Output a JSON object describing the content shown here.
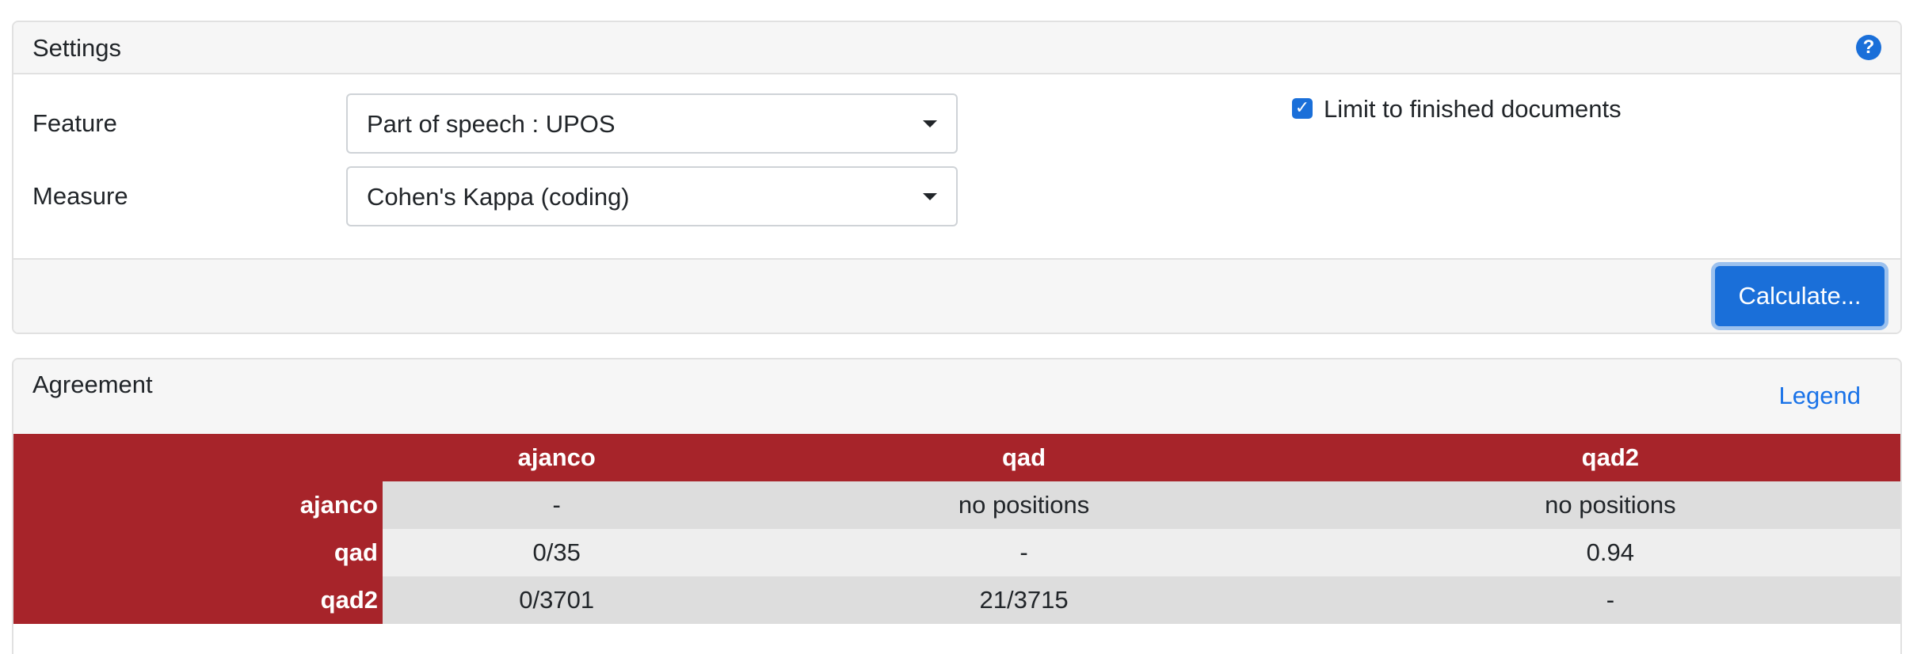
{
  "settings": {
    "title": "Settings",
    "help_icon": "?",
    "feature_label": "Feature",
    "feature_value": "Part of speech : UPOS",
    "measure_label": "Measure",
    "measure_value": "Cohen's Kappa (coding)",
    "limit_label": "Limit to finished documents",
    "limit_checked": true,
    "calculate_label": "Calculate..."
  },
  "agreement": {
    "title": "Agreement",
    "legend_label": "Legend",
    "header_color": "#a7242a",
    "columns": [
      "ajanco",
      "qad",
      "qad2"
    ],
    "rows": [
      {
        "label": "ajanco",
        "cells": [
          "-",
          "no positions",
          "no positions"
        ]
      },
      {
        "label": "qad",
        "cells": [
          "0/35",
          "-",
          "0.94"
        ]
      },
      {
        "label": "qad2",
        "cells": [
          "0/3701",
          "21/3715",
          "-"
        ]
      }
    ]
  },
  "colors": {
    "primary": "#1a6fd9",
    "link": "#1a73e8",
    "header_bg": "#f6f6f6"
  },
  "icons": {
    "help": "question-circle-icon",
    "dropdown": "chevron-down-icon",
    "checkbox": "check-icon"
  }
}
